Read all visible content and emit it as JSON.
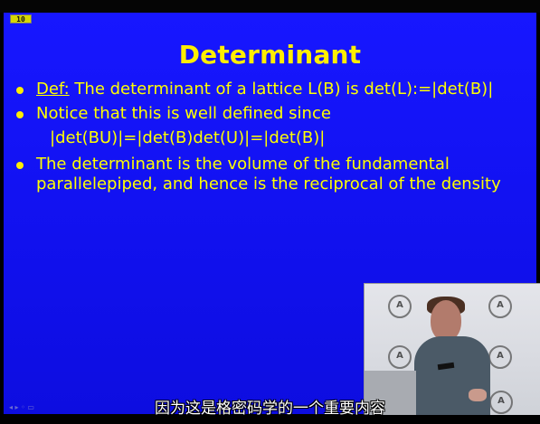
{
  "slide": {
    "number_label": "10",
    "title": "Determinant",
    "bullets": [
      {
        "label": "Def:",
        "text": " The determinant of a lattice L(B) is det(L):=|det(B)|"
      },
      {
        "text": "Notice that this is well defined since"
      },
      {
        "text": "The determinant is the volume of the fundamental parallelepiped, and hence is the reciprocal of the density"
      }
    ],
    "formula": "|det(BU)|=|det(B)det(U)|=|det(B)|"
  },
  "subtitle": "因为这是格密码学的一个重要内容",
  "colors": {
    "slide_background": "#1212f2",
    "text": "#ffff00",
    "video_background": "#dcdde2"
  },
  "icons": {
    "slide_number": "slide-number-icon",
    "bullet": "bullet-icon",
    "logo": "ashmolean-logo-icon"
  }
}
